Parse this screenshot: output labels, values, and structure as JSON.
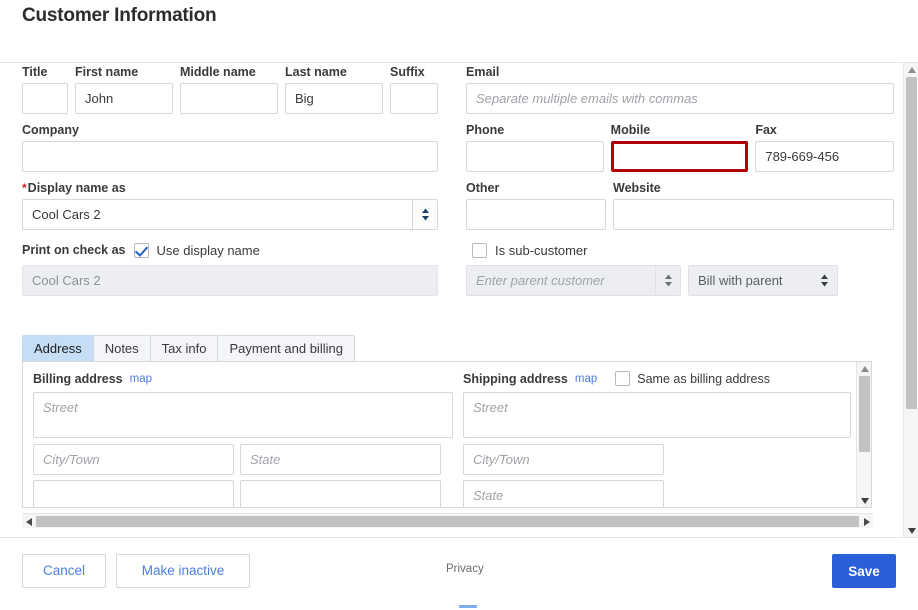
{
  "header": {
    "title": "Customer Information"
  },
  "name_row": {
    "fields": [
      {
        "label": "Title",
        "value": "",
        "placeholder": ""
      },
      {
        "label": "First name",
        "value": "John",
        "placeholder": ""
      },
      {
        "label": "Middle name",
        "value": "",
        "placeholder": ""
      },
      {
        "label": "Last name",
        "value": "Big",
        "placeholder": ""
      },
      {
        "label": "Suffix",
        "value": "",
        "placeholder": ""
      }
    ]
  },
  "company": {
    "label": "Company",
    "value": ""
  },
  "display_name": {
    "label": "Display name as",
    "required_marker": "*",
    "value": "Cool Cars 2",
    "caret_icon": "updown-caret-icon"
  },
  "print_on_check": {
    "label": "Print on check as",
    "checkbox_label": "Use display name",
    "checked": true,
    "value": "Cool Cars 2",
    "disabled": true
  },
  "email": {
    "label": "Email",
    "value": "",
    "placeholder": "Separate multiple emails with commas"
  },
  "phone_row": {
    "phone": {
      "label": "Phone",
      "value": ""
    },
    "mobile": {
      "label": "Mobile",
      "value": "",
      "error": true,
      "error_color": "#b00404"
    },
    "fax": {
      "label": "Fax",
      "value": "789-669-456"
    }
  },
  "other_row": {
    "other": {
      "label": "Other",
      "value": ""
    },
    "website": {
      "label": "Website",
      "value": ""
    }
  },
  "sub_customer": {
    "checkbox_label": "Is sub-customer",
    "checked": false,
    "parent_placeholder": "Enter parent customer",
    "billing_option": "Bill with parent",
    "disabled": true
  },
  "tabs": [
    {
      "label": "Address",
      "active": true
    },
    {
      "label": "Notes",
      "active": false
    },
    {
      "label": "Tax info",
      "active": false
    },
    {
      "label": "Payment and billing",
      "active": false
    }
  ],
  "billing_address": {
    "title": "Billing address",
    "map_link": "map",
    "street_placeholder": "Street",
    "city_placeholder": "City/Town",
    "state_placeholder": "State"
  },
  "shipping_address": {
    "title": "Shipping address",
    "map_link": "map",
    "same_as_billing_label": "Same as billing address",
    "same_as_billing_checked": false,
    "street_placeholder": "Street",
    "city_placeholder": "City/Town",
    "state_placeholder": "State"
  },
  "footer": {
    "cancel_label": "Cancel",
    "make_inactive_label": "Make inactive",
    "privacy_label": "Privacy",
    "save_label": "Save",
    "save_color": "#2b5fd9"
  }
}
